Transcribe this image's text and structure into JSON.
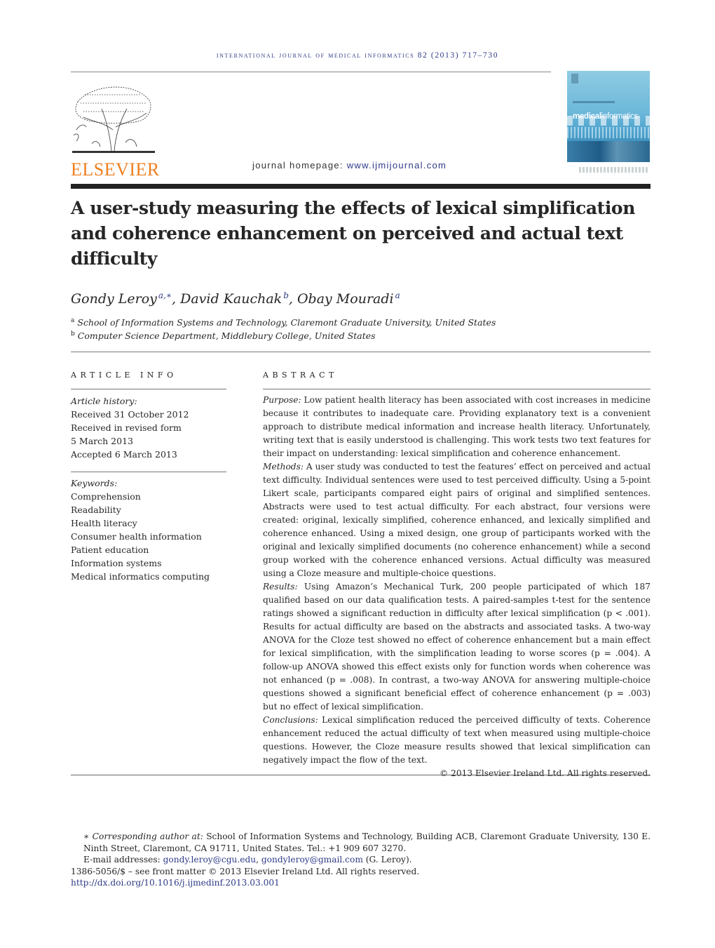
{
  "header": {
    "running_head": "International Journal of Medical Informatics 82 (2013) 717–730",
    "publisher_logo_text": "ELSEVIER",
    "homepage_label": "journal homepage: ",
    "homepage_url": "www.ijmijournal.com",
    "cover": {
      "title_part1": "medical",
      "title_part2": "informatics",
      "brand_color": "#f07f1f",
      "link_color": "#2e3a87"
    }
  },
  "article": {
    "title": "A user-study measuring the effects of lexical simplification and coherence enhancement on perceived and actual text difficulty",
    "authors": [
      {
        "name": "Gondy Leroy",
        "marks": "a,∗",
        "sep": ", "
      },
      {
        "name": "David Kauchak",
        "marks": "b",
        "sep": ", "
      },
      {
        "name": "Obay Mouradi",
        "marks": "a",
        "sep": ""
      }
    ],
    "affiliations": [
      {
        "mark": "a",
        "text": "School of Information Systems and Technology, Claremont Graduate University, United States"
      },
      {
        "mark": "b",
        "text": "Computer Science Department, Middlebury College, United States"
      }
    ]
  },
  "article_info": {
    "heading": "ARTICLE INFO",
    "history_label": "Article history:",
    "history": [
      "Received 31 October 2012",
      "Received in revised form",
      "5 March 2013",
      "Accepted 6 March 2013"
    ],
    "keywords_label": "Keywords:",
    "keywords": [
      "Comprehension",
      "Readability",
      "Health literacy",
      "Consumer health information",
      "Patient education",
      "Information systems",
      "Medical informatics computing"
    ]
  },
  "abstract": {
    "heading": "ABSTRACT",
    "sections": [
      {
        "label": "Purpose:",
        "text": " Low patient health literacy has been associated with cost increases in medicine because it contributes to inadequate care. Providing explanatory text is a convenient approach to distribute medical information and increase health literacy. Unfortunately, writing text that is easily understood is challenging. This work tests two text features for their impact on understanding: lexical simplification and coherence enhancement."
      },
      {
        "label": "Methods:",
        "text": " A user study was conducted to test the features’ effect on perceived and actual text difficulty. Individual sentences were used to test perceived difficulty. Using a 5-point Likert scale, participants compared eight pairs of original and simplified sentences. Abstracts were used to test actual difficulty. For each abstract, four versions were created: original, lexically simplified, coherence enhanced, and lexically simplified and coherence enhanced. Using a mixed design, one group of participants worked with the original and lexically simplified documents (no coherence enhancement) while a second group worked with the coherence enhanced versions. Actual difficulty was measured using a Cloze measure and multiple-choice questions."
      },
      {
        "label": "Results:",
        "text": " Using Amazon’s Mechanical Turk, 200 people participated of which 187 qualified based on our data qualification tests. A paired-samples t-test for the sentence ratings showed a significant reduction in difficulty after lexical simplification (p < .001). Results for actual difficulty are based on the abstracts and associated tasks. A two-way ANOVA for the Cloze test showed no effect of coherence enhancement but a main effect for lexical simplification, with the simplification leading to worse scores (p = .004). A follow-up ANOVA showed this effect exists only for function words when coherence was not enhanced (p = .008). In contrast, a two-way ANOVA for answering multiple-choice questions showed a significant beneficial effect of coherence enhancement (p = .003) but no effect of lexical simplification."
      },
      {
        "label": "Conclusions:",
        "text": " Lexical simplification reduced the perceived difficulty of texts. Coherence enhancement reduced the actual difficulty of text when measured using multiple-choice questions. However, the Cloze measure results showed that lexical simplification can negatively impact the flow of the text."
      }
    ],
    "copyright": "© 2013 Elsevier Ireland Ltd. All rights reserved."
  },
  "footnotes": {
    "corresponding_mark": "∗",
    "corresponding_label": "Corresponding author at:",
    "corresponding_text": " School of Information Systems and Technology, Building ACB, Claremont Graduate University, 130 E. Ninth Street, Claremont, CA 91711, United States. Tel.: +1 909 607 3270.",
    "email_label": "E-mail addresses: ",
    "email_1": "gondy.leroy@cgu.edu",
    "email_sep": ", ",
    "email_2": "gondyleroy@gmail.com",
    "email_suffix": " (G. Leroy).",
    "issn_line": "1386-5056/$ – see front matter © 2013 Elsevier Ireland Ltd. All rights reserved.",
    "doi": "http://dx.doi.org/10.1016/j.ijmedinf.2013.03.001"
  }
}
